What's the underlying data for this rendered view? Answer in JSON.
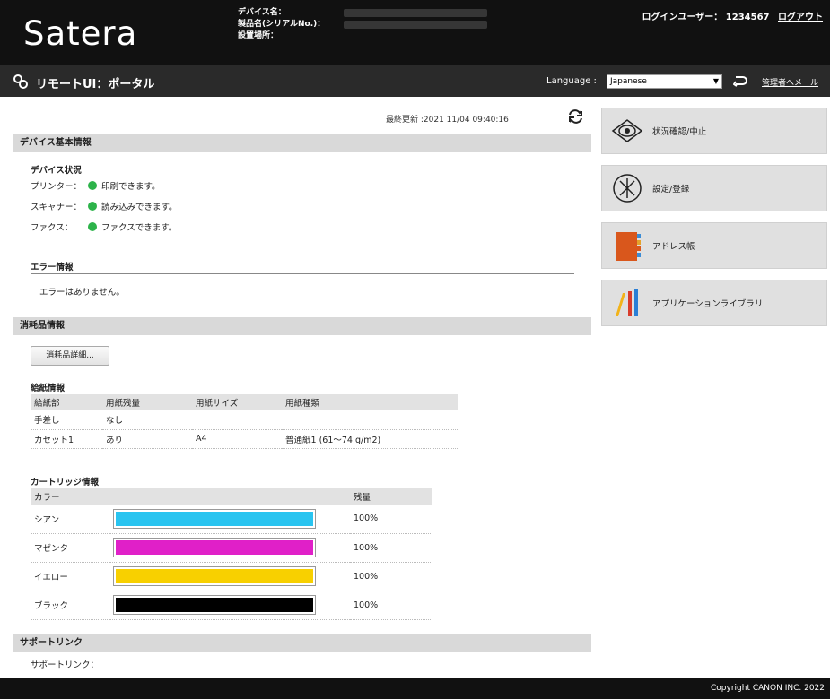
{
  "header": {
    "logo": "Satera",
    "device_name_label": "デバイス名：",
    "product_name_label": "製品名(シリアルNo.)：",
    "location_label": "設置場所：",
    "login_label": "ログインユーザー：",
    "login_user": "1234567",
    "logout": "ログアウト"
  },
  "subbar": {
    "title": "リモートUI：ポータル",
    "language_label": "Language :",
    "language_value": "Japanese",
    "admin_mail": "管理者へメール"
  },
  "main": {
    "last_updated": "最終更新 :2021 11/04 09:40:16",
    "device_info": {
      "title": "デバイス基本情報",
      "status_title": "デバイス状況",
      "statuses": [
        {
          "label": "プリンター：",
          "text": "印刷できます。",
          "color": "#2db34a"
        },
        {
          "label": "スキャナー：",
          "text": "読み込みできます。",
          "color": "#2db34a"
        },
        {
          "label": "ファクス：",
          "text": "ファクスできます。",
          "color": "#2db34a"
        }
      ],
      "error_title": "エラー情報",
      "error_text": "エラーはありません。"
    },
    "consumables": {
      "title": "消耗品情報",
      "detail_button": "消耗品詳細...",
      "paper_title": "給紙情報",
      "paper_headers": [
        "給紙部",
        "用紙残量",
        "用紙サイズ",
        "用紙種類"
      ],
      "paper_rows": [
        [
          "手差し",
          "なし",
          "",
          ""
        ],
        [
          "カセット1",
          "あり",
          "A4",
          "普通紙1 (61～74 g/m2)"
        ]
      ],
      "cartridge_title": "カートリッジ情報",
      "cartridge_headers": [
        "カラー",
        "",
        "残量"
      ],
      "cartridges": [
        {
          "name": "シアン",
          "level": "100%",
          "fraction": 1.0,
          "color": "#29c4f0"
        },
        {
          "name": "マゼンタ",
          "level": "100%",
          "fraction": 1.0,
          "color": "#e020c8"
        },
        {
          "name": "イエロー",
          "level": "100%",
          "fraction": 1.0,
          "color": "#f8d000"
        },
        {
          "name": "ブラック",
          "level": "100%",
          "fraction": 1.0,
          "color": "#000000"
        }
      ]
    },
    "support": {
      "title": "サポートリンク",
      "label": "サポートリンク："
    }
  },
  "nav": [
    {
      "label": "状況確認/中止",
      "icon": "eye-icon"
    },
    {
      "label": "設定/登録",
      "icon": "settings-icon"
    },
    {
      "label": "アドレス帳",
      "icon": "address-book-icon"
    },
    {
      "label": "アプリケーションライブラリ",
      "icon": "app-library-icon"
    }
  ],
  "footer": {
    "copyright": "Copyright CANON INC. 2022"
  }
}
